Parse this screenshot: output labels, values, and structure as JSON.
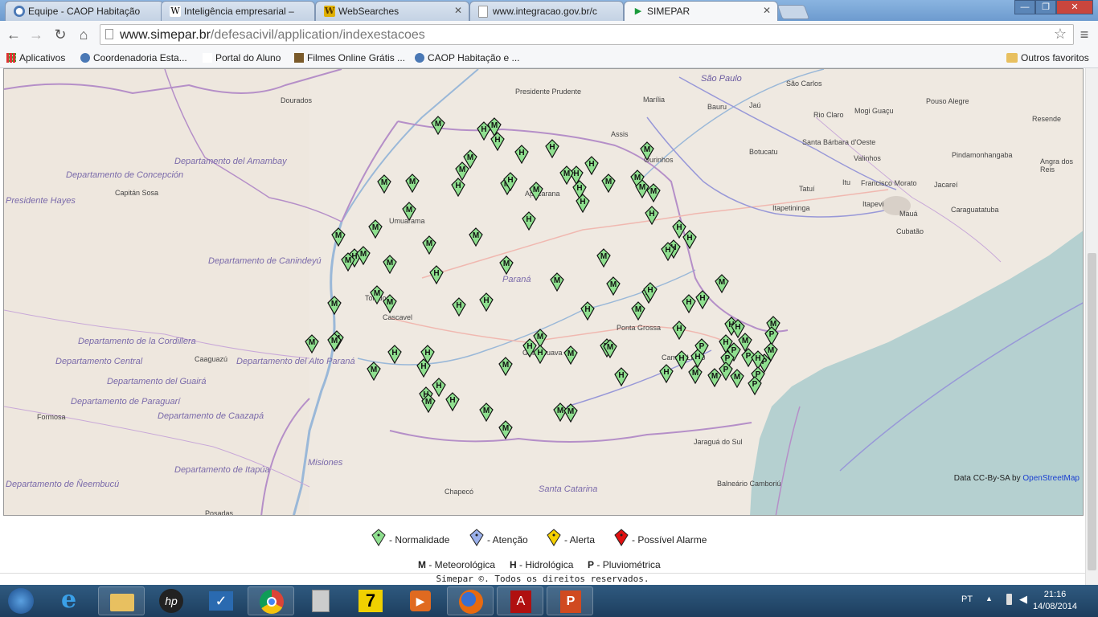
{
  "browser": {
    "tabs": [
      {
        "title": "Equipe - CAOP Habitação",
        "icon": "globe-icon",
        "active": false
      },
      {
        "title": "Inteligência empresarial –",
        "icon": "wikipedia-icon",
        "active": false
      },
      {
        "title": "WebSearches",
        "icon": "websearch-icon",
        "active": false
      },
      {
        "title": "www.integracao.gov.br/c",
        "icon": "page-icon",
        "active": false
      },
      {
        "title": "SIMEPAR",
        "icon": "simepar-icon",
        "active": true
      }
    ],
    "url_host": "www.simepar.br",
    "url_path": "/defesacivil/application/indexestacoes",
    "bookmarks": [
      {
        "label": "Aplicativos",
        "icon": "apps-grid-icon"
      },
      {
        "label": "Coordenadoria Esta...",
        "icon": "globe-icon"
      },
      {
        "label": "Portal do Aluno",
        "icon": "page-icon"
      },
      {
        "label": "Filmes Online Grátis ...",
        "icon": "film-icon"
      },
      {
        "label": "CAOP Habitação e ...",
        "icon": "globe-icon"
      }
    ],
    "other_bookmarks": "Outros favoritos"
  },
  "map": {
    "attribution_prefix": "Data CC-By-SA by",
    "attribution_link": "OpenStreetMap",
    "place_labels": {
      "sao_paulo": "São Paulo",
      "sao_carlos": "São Carlos",
      "dourados": "Dourados",
      "presidente_prudente": "Presidente Prudente",
      "marilia": "Marília",
      "bauru": "Bauru",
      "jau": "Jaú",
      "rio_claro": "Rio Claro",
      "mogi_guacu": "Mogi Guaçu",
      "pouso_alegre": "Pouso Alegre",
      "resende": "Resende",
      "assis": "Assis",
      "ourinhos": "Ourinhos",
      "botucatu": "Botucatu",
      "santa_barbara": "Santa Bárbara d'Oeste",
      "pindamonhangaba": "Pindamonhangaba",
      "angra": "Angra dos Reis",
      "amambay": "Departamento del Amambay",
      "valinhos": "Valinhos",
      "concepcion": "Departamento de Concepción",
      "capitan_sosa": "Capitán Sosa",
      "tatui": "Tatuí",
      "itu": "Itu",
      "francisco_morato": "Francisco Morato",
      "jacarei": "Jacareí",
      "presidente_hayes": "Presidente Hayes",
      "apucarana": "Apucarana",
      "itapevi": "Itapevi",
      "itapetininga": "Itapetininga",
      "maua": "Mauá",
      "caraguatatuba": "Caraguatatuba",
      "umuarama": "Umuarama",
      "cubatao": "Cubatão",
      "canindeyu": "Departamento de Canindeyú",
      "parana": "Paraná",
      "toledo": "Toledo",
      "cascavel": "Cascavel",
      "ponta_grossa": "Ponta Grossa",
      "cordillera": "Departamento de la Cordillera",
      "guarapuava": "Guarapuava",
      "campo_largo": "Campo Largo",
      "caaguazu": "Caaguazú",
      "central": "Departamento Central",
      "alto_parana": "Departamento del Alto Paraná",
      "guaira": "Departamento del Guairá",
      "paraguari": "Departamento de Paraguarí",
      "formosa": "Formosa",
      "caazapa": "Departamento de Caazapá",
      "jaragua": "Jaraguá do Sul",
      "misiones": "Misiones",
      "itapua": "Departamento de Itapúa",
      "neembucu": "Departamento de Ñeembucú",
      "chapeco": "Chapecó",
      "santa_catarina": "Santa Catarina",
      "balneario": "Balneário Camboriú",
      "posadas": "Posadas"
    },
    "stations": [
      {
        "t": "M",
        "s": "normal"
      },
      {
        "t": "H",
        "s": "normal"
      },
      {
        "t": "M",
        "s": "normal"
      },
      {
        "t": "H",
        "s": "normal"
      },
      {
        "t": "H",
        "s": "normal"
      },
      {
        "t": "H",
        "s": "normal"
      },
      {
        "t": "M",
        "s": "normal"
      },
      {
        "t": "M",
        "s": "normal"
      },
      {
        "t": "M",
        "s": "normal"
      },
      {
        "t": "H",
        "s": "normal"
      },
      {
        "t": "H",
        "s": "normal"
      },
      {
        "t": "M",
        "s": "normal"
      },
      {
        "t": "M",
        "s": "normal"
      },
      {
        "t": "M",
        "s": "normal"
      },
      {
        "t": "M",
        "s": "normal"
      },
      {
        "t": "H",
        "s": "normal"
      },
      {
        "t": "M",
        "s": "normal"
      },
      {
        "t": "H",
        "s": "normal"
      },
      {
        "t": "M",
        "s": "normal"
      },
      {
        "t": "H",
        "s": "normal"
      },
      {
        "t": "H",
        "s": "normal"
      },
      {
        "t": "M",
        "s": "normal"
      },
      {
        "t": "M",
        "s": "normal"
      },
      {
        "t": "M",
        "s": "normal"
      },
      {
        "t": "M",
        "s": "normal"
      },
      {
        "t": "H",
        "s": "normal"
      },
      {
        "t": "H",
        "s": "normal"
      },
      {
        "t": "M",
        "s": "normal"
      },
      {
        "t": "H",
        "s": "normal"
      },
      {
        "t": "M",
        "s": "normal"
      },
      {
        "t": "M",
        "s": "normal"
      },
      {
        "t": "H",
        "s": "normal"
      },
      {
        "t": "H",
        "s": "normal"
      },
      {
        "t": "H",
        "s": "normal"
      },
      {
        "t": "M",
        "s": "normal"
      },
      {
        "t": "M",
        "s": "normal"
      },
      {
        "t": "H",
        "s": "normal"
      },
      {
        "t": "M",
        "s": "normal"
      },
      {
        "t": "M",
        "s": "normal"
      },
      {
        "t": "M",
        "s": "normal"
      },
      {
        "t": "M",
        "s": "normal"
      },
      {
        "t": "H",
        "s": "normal"
      },
      {
        "t": "M",
        "s": "normal"
      },
      {
        "t": "M",
        "s": "normal"
      },
      {
        "t": "M",
        "s": "normal"
      },
      {
        "t": "H",
        "s": "normal"
      },
      {
        "t": "H",
        "s": "normal"
      },
      {
        "t": "H",
        "s": "normal"
      },
      {
        "t": "M",
        "s": "normal"
      },
      {
        "t": "M",
        "s": "normal"
      },
      {
        "t": "M",
        "s": "normal"
      },
      {
        "t": "M",
        "s": "normal"
      },
      {
        "t": "H",
        "s": "normal"
      },
      {
        "t": "H",
        "s": "normal"
      },
      {
        "t": "M",
        "s": "normal"
      },
      {
        "t": "H",
        "s": "normal"
      },
      {
        "t": "M",
        "s": "normal"
      },
      {
        "t": "M",
        "s": "normal"
      },
      {
        "t": "M",
        "s": "normal"
      },
      {
        "t": "H",
        "s": "normal"
      },
      {
        "t": "H",
        "s": "normal"
      },
      {
        "t": "H",
        "s": "normal"
      },
      {
        "t": "M",
        "s": "normal"
      },
      {
        "t": "M",
        "s": "normal"
      },
      {
        "t": "M",
        "s": "normal"
      },
      {
        "t": "H",
        "s": "normal"
      },
      {
        "t": "H",
        "s": "normal"
      },
      {
        "t": "M",
        "s": "normal"
      },
      {
        "t": "M",
        "s": "normal"
      },
      {
        "t": "M",
        "s": "normal"
      },
      {
        "t": "H",
        "s": "normal"
      },
      {
        "t": "H",
        "s": "normal"
      },
      {
        "t": "H",
        "s": "normal"
      },
      {
        "t": "H",
        "s": "normal"
      },
      {
        "t": "M",
        "s": "normal"
      },
      {
        "t": "P",
        "s": "normal"
      },
      {
        "t": "M",
        "s": "normal"
      },
      {
        "t": "P",
        "s": "normal"
      },
      {
        "t": "P",
        "s": "normal"
      },
      {
        "t": "P",
        "s": "normal"
      },
      {
        "t": "P",
        "s": "normal"
      },
      {
        "t": "H",
        "s": "normal"
      },
      {
        "t": "H",
        "s": "normal"
      },
      {
        "t": "P",
        "s": "normal"
      },
      {
        "t": "P",
        "s": "normal"
      },
      {
        "t": "H",
        "s": "normal"
      },
      {
        "t": "M",
        "s": "normal"
      },
      {
        "t": "M",
        "s": "normal"
      },
      {
        "t": "M",
        "s": "normal"
      },
      {
        "t": "M",
        "s": "normal"
      },
      {
        "t": "H",
        "s": "normal"
      },
      {
        "t": "H",
        "s": "normal"
      },
      {
        "t": "P",
        "s": "normal"
      },
      {
        "t": "P",
        "s": "normal"
      }
    ]
  },
  "legend": {
    "statuses": [
      {
        "label": "- Normalidade",
        "color": "#8fe08f"
      },
      {
        "label": "- Atenção",
        "color": "#9ab0ea"
      },
      {
        "label": "- Alerta",
        "color": "#f5d000"
      },
      {
        "label": "- Possível Alarme",
        "color": "#e01010"
      }
    ],
    "types": [
      {
        "code": "M",
        "label": "- Meteorológica"
      },
      {
        "code": "H",
        "label": "- Hidrológica"
      },
      {
        "code": "P",
        "label": "- Pluviométrica"
      }
    ]
  },
  "footer": "Simepar ©. Todos os direitos reservados.",
  "taskbar": {
    "apps": [
      "windows-start-icon",
      "internet-explorer-icon",
      "file-explorer-icon",
      "hp-icon",
      "checkmark-app-icon",
      "chrome-icon",
      "calculator-icon",
      "seven-icon",
      "media-player-icon",
      "firefox-icon",
      "acrobat-icon",
      "powerpoint-icon"
    ],
    "lang": "PT",
    "time": "21:16",
    "date": "14/08/2014"
  }
}
